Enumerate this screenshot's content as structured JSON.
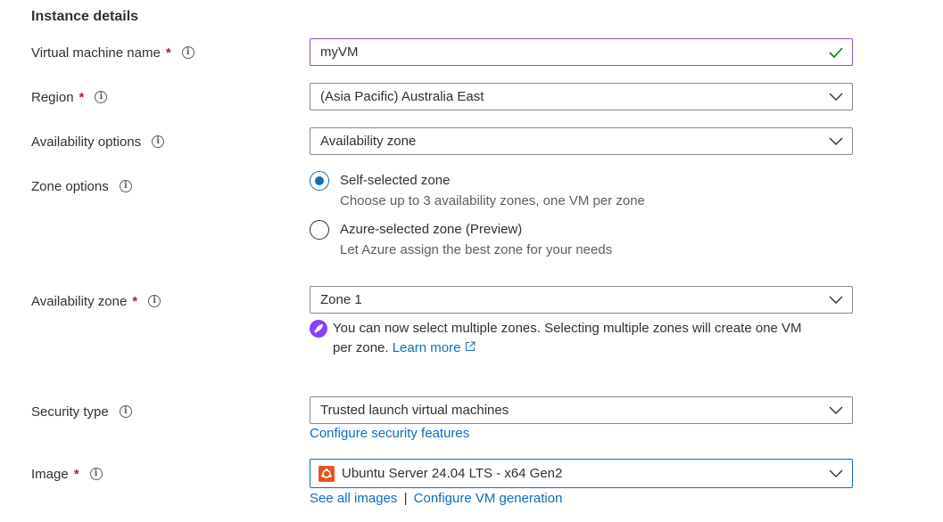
{
  "section": {
    "title": "Instance details"
  },
  "vm_name": {
    "label": "Virtual machine name",
    "required": "*",
    "value": "myVM",
    "validation_icon": "check-icon"
  },
  "region": {
    "label": "Region",
    "required": "*",
    "value": "(Asia Pacific) Australia East"
  },
  "availability_options": {
    "label": "Availability options",
    "value": "Availability zone"
  },
  "zone_options": {
    "label": "Zone options",
    "options": [
      {
        "title": "Self-selected zone",
        "desc": "Choose up to 3 availability zones, one VM per zone",
        "selected": true
      },
      {
        "title": "Azure-selected zone (Preview)",
        "desc": "Let Azure assign the best zone for your needs",
        "selected": false
      }
    ]
  },
  "availability_zone": {
    "label": "Availability zone",
    "required": "*",
    "value": "Zone 1",
    "note_line1": "You can now select multiple zones. Selecting multiple zones will create one VM",
    "note_line2": "per zone.",
    "learn_more": "Learn more"
  },
  "security_type": {
    "label": "Security type",
    "value": "Trusted launch virtual machines",
    "link": "Configure security features"
  },
  "image": {
    "label": "Image",
    "required": "*",
    "value": "Ubuntu Server 24.04 LTS - x64 Gen2",
    "link_all": "See all images",
    "separator": "|",
    "link_generation": "Configure VM generation"
  },
  "colors": {
    "accent": "#0f6cbd",
    "required": "#a4262c",
    "focus": "#8a4fc8",
    "valid": "#107c10",
    "ubuntu": "#e95420"
  }
}
